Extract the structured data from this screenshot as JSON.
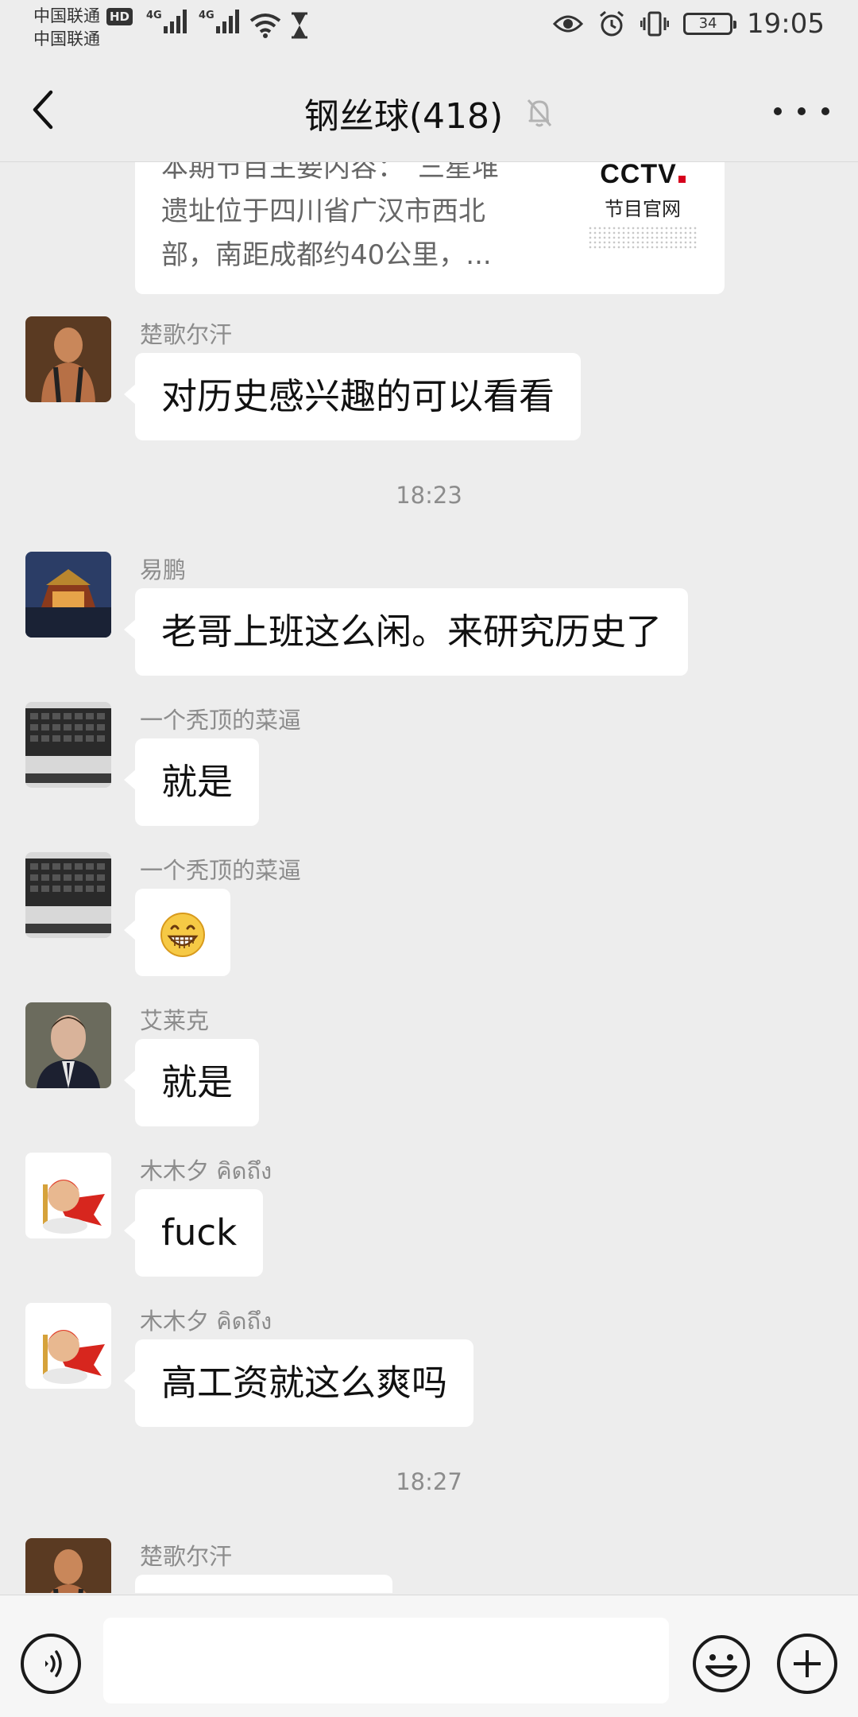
{
  "status_bar": {
    "carrier1": "中国联通",
    "carrier2": "中国联通",
    "hd": "HD",
    "net1": "4G",
    "net2": "4G",
    "battery": "34",
    "time": "19:05",
    "icons": [
      "signal-icon",
      "wifi-icon",
      "hourglass-icon",
      "eye-icon",
      "alarm-icon",
      "vibrate-icon",
      "battery-icon"
    ]
  },
  "header": {
    "title": "钢丝球(418)",
    "back_icon": "chevron-left-icon",
    "mute_icon": "bell-off-icon",
    "more_icon": "more-icon"
  },
  "link_card": {
    "line1": "本期节目主要内容：　三星堆",
    "line2": "遗址位于四川省广汉市西北",
    "line3": "部，南距成都约40公里，...",
    "thumb_logo": "CCTV",
    "thumb_sub": "节目官网"
  },
  "messages": [
    {
      "sender": "楚歌尔汗",
      "text": "对历史感兴趣的可以看看"
    },
    {
      "sender": "易鹏",
      "text": "老哥上班这么闲。来研究历史了"
    },
    {
      "sender": "一个秃顶的菜逼",
      "text": "就是"
    },
    {
      "sender": "一个秃顶的菜逼",
      "text": "😁"
    },
    {
      "sender": "艾莱克",
      "text": "就是"
    },
    {
      "sender": "木木夕 คิดถึง",
      "text": "fuck"
    },
    {
      "sender": "木木夕 คิดถึง",
      "text": "高工资就这么爽吗"
    },
    {
      "sender": "楚歌尔汗",
      "text": ""
    }
  ],
  "timestamps": [
    "18:23",
    "18:27"
  ],
  "input_bar": {
    "voice_icon": "voice-icon",
    "placeholder": "",
    "emoji_icon": "emoji-icon",
    "plus_icon": "plus-icon"
  }
}
